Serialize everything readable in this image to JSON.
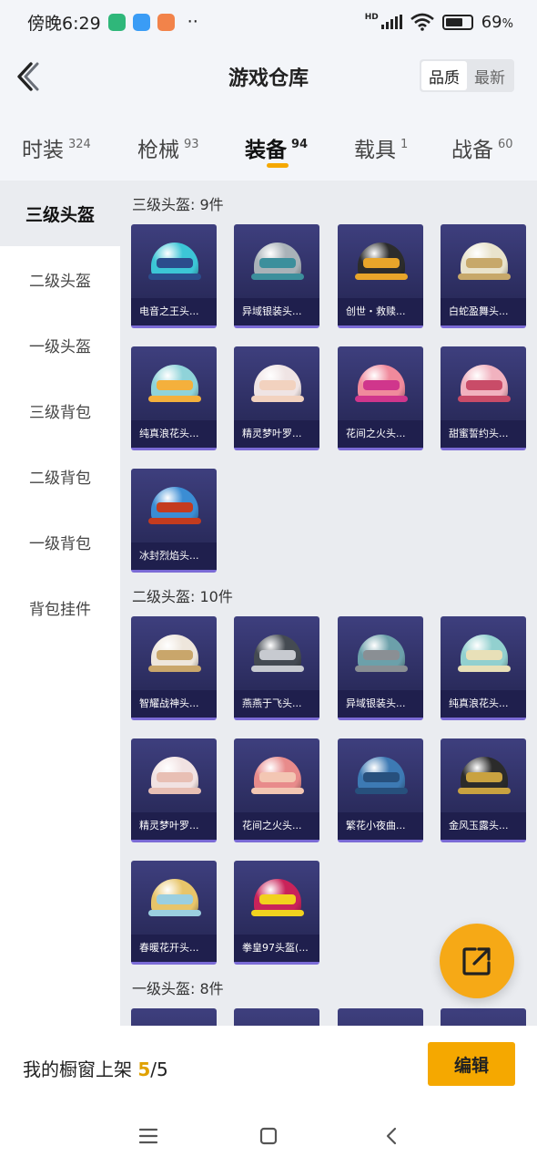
{
  "status_bar": {
    "time": "傍晚6:29",
    "dots": "··",
    "net": "HD",
    "battery": "69",
    "battery_level": 0.69
  },
  "header": {
    "title": "游戏仓库",
    "sort": [
      "品质",
      "最新"
    ],
    "active_sort": 0
  },
  "tabs": [
    {
      "label": "时装",
      "count": "324"
    },
    {
      "label": "枪械",
      "count": "93"
    },
    {
      "label": "装备",
      "count": "94"
    },
    {
      "label": "载具",
      "count": "1"
    },
    {
      "label": "战备",
      "count": "60"
    }
  ],
  "active_tab": 2,
  "sidebar": {
    "items": [
      {
        "label": "三级头盔"
      },
      {
        "label": "二级头盔"
      },
      {
        "label": "一级头盔"
      },
      {
        "label": "三级背包"
      },
      {
        "label": "二级背包"
      },
      {
        "label": "一级背包"
      },
      {
        "label": "背包挂件"
      }
    ],
    "active": 0
  },
  "sections": [
    {
      "title": "三级头盔: 9件",
      "items": [
        {
          "name": "电音之王头...",
          "color": "#3cc6d6",
          "visor": "#2b4d8c"
        },
        {
          "name": "异域银装头...",
          "color": "#a9b2b8",
          "visor": "#3c8f9c"
        },
        {
          "name": "创世・救赎...",
          "color": "#2c2c2c",
          "visor": "#e8a52a"
        },
        {
          "name": "白蛇盈舞头...",
          "color": "#e9e3cc",
          "visor": "#c7a86a"
        },
        {
          "name": "纯真浪花头...",
          "color": "#8fd3d9",
          "visor": "#f4b03c"
        },
        {
          "name": "精灵梦叶罗...",
          "color": "#efe4e4",
          "visor": "#f2d2bf"
        },
        {
          "name": "花间之火头...",
          "color": "#f08a9c",
          "visor": "#d0368c"
        },
        {
          "name": "甜蜜誓约头...",
          "color": "#f1b2bf",
          "visor": "#c94c68"
        },
        {
          "name": "冰封烈焰头...",
          "color": "#3b8dd4",
          "visor": "#c43b1e"
        }
      ]
    },
    {
      "title": "二级头盔: 10件",
      "items": [
        {
          "name": "智耀战神头...",
          "color": "#eee6dc",
          "visor": "#c9a66b"
        },
        {
          "name": "燕燕于飞头...",
          "color": "#444a52",
          "visor": "#c7cad0"
        },
        {
          "name": "异域银装头...",
          "color": "#6ca0aa",
          "visor": "#8a8f94"
        },
        {
          "name": "纯真浪花头...",
          "color": "#92d0cf",
          "visor": "#e8e0b8"
        },
        {
          "name": "精灵梦叶罗...",
          "color": "#f1e2e2",
          "visor": "#e8bfb4"
        },
        {
          "name": "花间之火头...",
          "color": "#e88b8b",
          "visor": "#f3c6b3"
        },
        {
          "name": "繁花小夜曲...",
          "color": "#3d7ab4",
          "visor": "#27507d"
        },
        {
          "name": "金风玉露头...",
          "color": "#2b2b2b",
          "visor": "#c9a240"
        },
        {
          "name": "春暖花开头...",
          "color": "#e8c56a",
          "visor": "#9bcfe0"
        },
        {
          "name": "拳皇97头盔(...",
          "color": "#c9235a",
          "visor": "#f1d21e"
        }
      ]
    },
    {
      "title": "一级头盔: 8件",
      "items": [
        {
          "name": "",
          "color": "#3a3b78",
          "visor": "#3a3b78"
        },
        {
          "name": "",
          "color": "#3a3b78",
          "visor": "#3a3b78"
        },
        {
          "name": "",
          "color": "#3a3b78",
          "visor": "#3a3b78"
        },
        {
          "name": "",
          "color": "#3a3b78",
          "visor": "#3a3b78"
        }
      ]
    }
  ],
  "footer": {
    "label": "我的橱窗上架",
    "count": "5",
    "total": "/5",
    "edit": "编辑"
  }
}
